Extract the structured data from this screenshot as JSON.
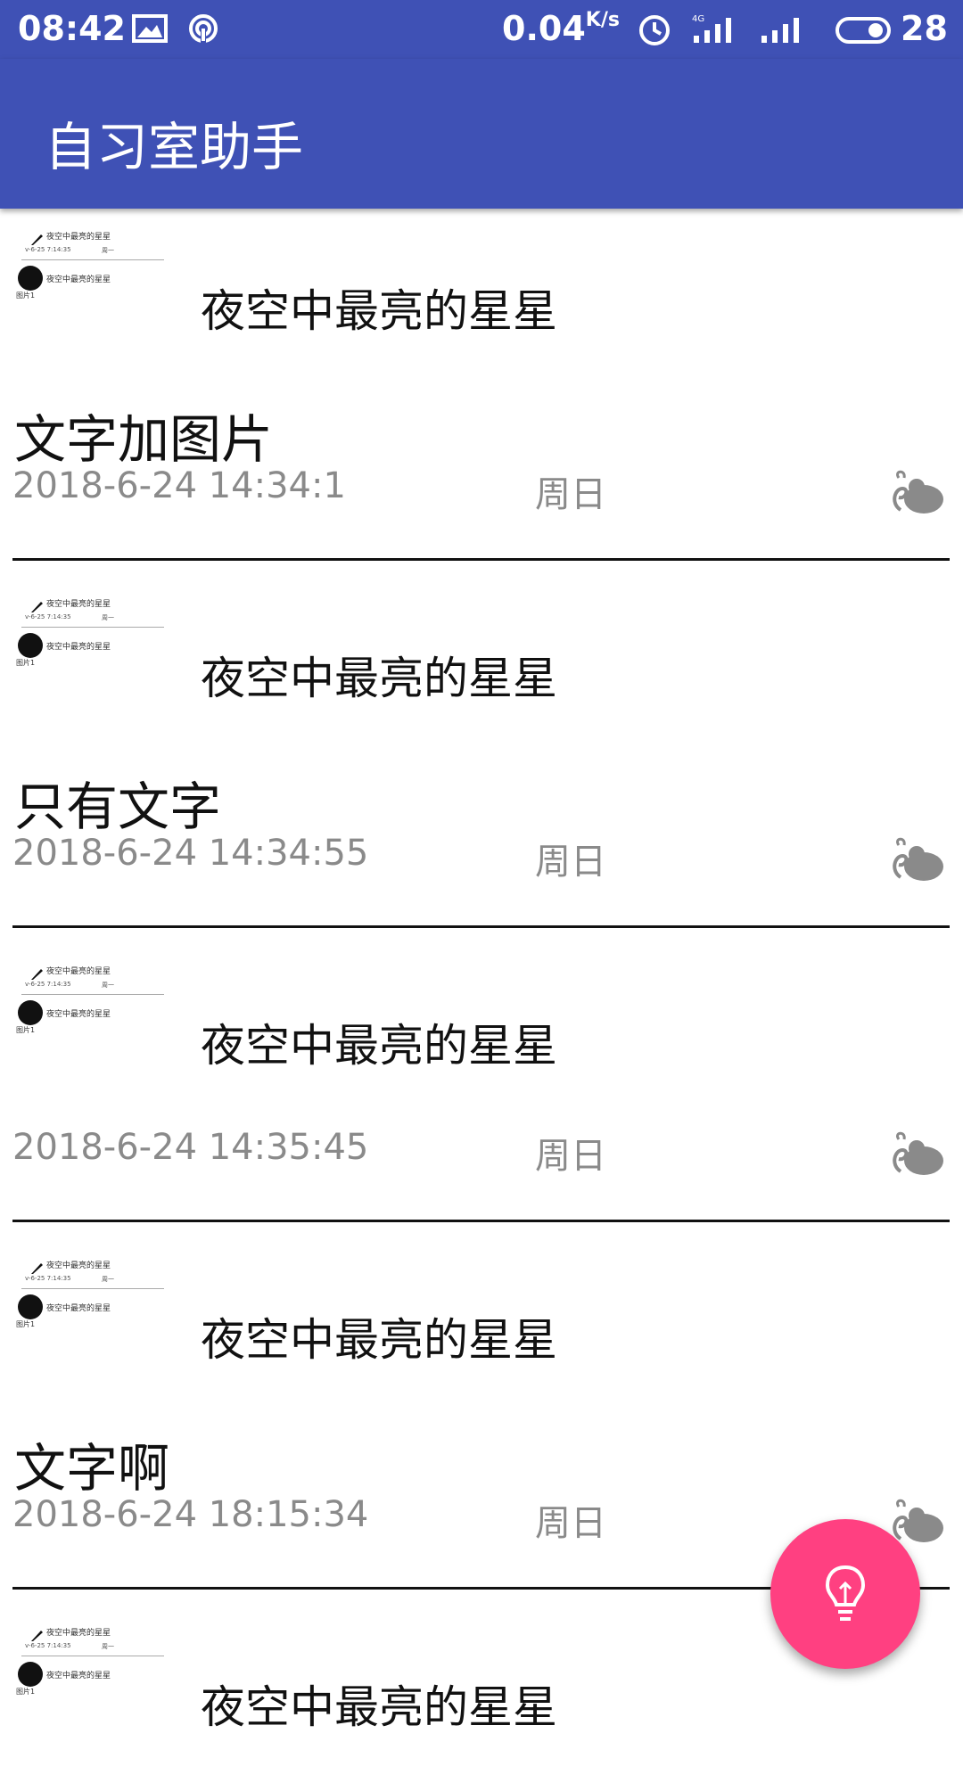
{
  "status_bar": {
    "time": "08:42",
    "speed": "0.04",
    "speed_unit": "K/s",
    "battery": "28"
  },
  "app_bar": {
    "title": "自习室助手"
  },
  "thumbnail": {
    "line1": "夜空中最亮的星星",
    "line2": "v-6-25 7:14:35",
    "line3": "周一",
    "line4": "夜空中最亮的星星",
    "line5": "图片1"
  },
  "notes": [
    {
      "heading": "夜空中最亮的星星",
      "body": "文字加图片",
      "datetime": "2018-6-24 14:34:1",
      "weekday": "周日"
    },
    {
      "heading": "夜空中最亮的星星",
      "body": "只有文字",
      "datetime": "2018-6-24 14:34:55",
      "weekday": "周日"
    },
    {
      "heading": "夜空中最亮的星星",
      "body": "",
      "datetime": "2018-6-24 14:35:45",
      "weekday": "周日"
    },
    {
      "heading": "夜空中最亮的星星",
      "body": "文字啊",
      "datetime": "2018-6-24 18:15:34",
      "weekday": "周日"
    },
    {
      "heading": "夜空中最亮的星星",
      "body": "",
      "datetime": "",
      "weekday": ""
    }
  ],
  "colors": {
    "primary": "#3f51b5",
    "accent": "#ff4081",
    "secondary_text": "#8a8a8a"
  },
  "icons": {
    "fab": "lightbulb-icon",
    "mood": "mood-decoration-icon"
  }
}
